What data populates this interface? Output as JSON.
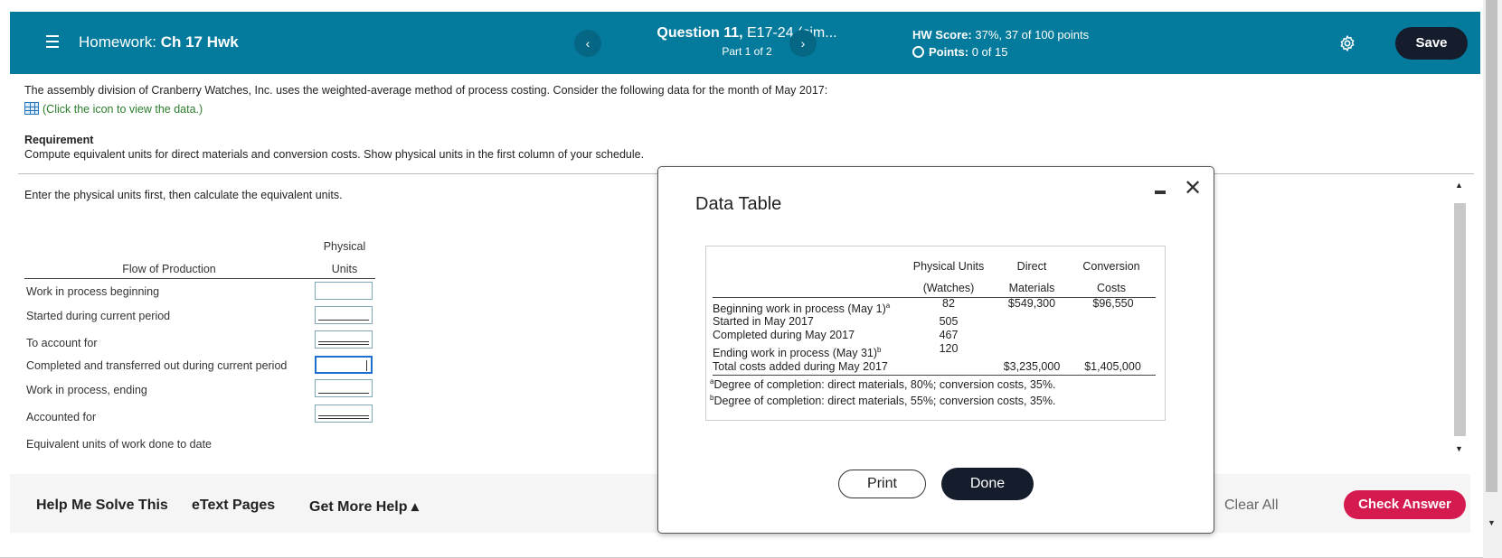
{
  "header": {
    "hw_prefix": "Homework:",
    "hw_name": "Ch 17 Hwk",
    "question_label": "Question 11,",
    "question_id": "E17-24 (sim...",
    "part": "Part 1 of 2",
    "score_label": "HW Score:",
    "score_value": "37%, 37 of 100 points",
    "points_label": "Points:",
    "points_value": "0 of 15",
    "save_label": "Save",
    "prev_icon": "‹",
    "next_icon": "›"
  },
  "problem": {
    "intro": "The assembly division of Cranberry Watches, Inc. uses the weighted-average method of process costing. Consider the following data for the month of May 2017:",
    "data_link": "(Click the icon to view the data.)",
    "requirement_heading": "Requirement",
    "requirement_text": "Compute equivalent units for direct materials and conversion costs. Show physical units in the first column of your schedule.",
    "instruction": "Enter the physical units first, then calculate the equivalent units."
  },
  "schedule": {
    "col_flow": "Flow of Production",
    "col_phys_1": "Physical",
    "col_phys_2": "Units",
    "rows": [
      "Work in process beginning",
      "Started during current period",
      "To account for",
      "Completed and transferred out during current period",
      "Work in process, ending",
      "Accounted for",
      "Equivalent units of work done to date"
    ]
  },
  "footer": {
    "help": "Help Me Solve This",
    "etext": "eText Pages",
    "more_help": "Get More Help ▴",
    "clear_all": "Clear All",
    "check_answer": "Check Answer"
  },
  "modal": {
    "title": "Data Table",
    "headers": {
      "pu_1": "Physical Units",
      "pu_2": "(Watches)",
      "dm_1": "Direct",
      "dm_2": "Materials",
      "cc_1": "Conversion",
      "cc_2": "Costs"
    },
    "rows": [
      {
        "label": "Beginning work in process (May 1)",
        "sup": "a",
        "units": "82",
        "dm": "$549,300",
        "cc": "$96,550"
      },
      {
        "label": "Started in May 2017",
        "sup": "",
        "units": "505",
        "dm": "",
        "cc": ""
      },
      {
        "label": "Completed during May 2017",
        "sup": "",
        "units": "467",
        "dm": "",
        "cc": ""
      },
      {
        "label": "Ending work in process (May 31)",
        "sup": "b",
        "units": "120",
        "dm": "",
        "cc": ""
      },
      {
        "label": "Total costs added during May 2017",
        "sup": "",
        "units": "",
        "dm": "$3,235,000",
        "cc": "$1,405,000"
      }
    ],
    "note_a_mark": "a",
    "note_a": "Degree of completion: direct materials, 80%; conversion costs, 35%.",
    "note_b_mark": "b",
    "note_b": "Degree of completion: direct materials, 55%; conversion costs, 35%.",
    "print_label": "Print",
    "done_label": "Done"
  }
}
